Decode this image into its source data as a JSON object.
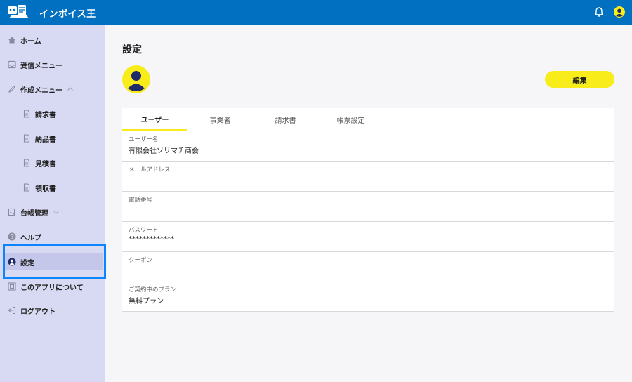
{
  "header": {
    "app_title": "インボイス王",
    "logo_icon": "app-logo-icon",
    "bell_icon": "bell-icon",
    "account_icon": "account-avatar-icon",
    "color": "#0270c0"
  },
  "sidebar": {
    "background": "#d8d9f3",
    "items": [
      {
        "label": "ホーム",
        "icon": "home-icon"
      },
      {
        "label": "受信メニュー",
        "icon": "inbox-icon"
      },
      {
        "label": "作成メニュー",
        "icon": "pencil-icon",
        "expanded": true
      },
      {
        "label": "請求書",
        "icon": "document-icon"
      },
      {
        "label": "納品書",
        "icon": "document-icon"
      },
      {
        "label": "見積書",
        "icon": "document-icon"
      },
      {
        "label": "領収書",
        "icon": "document-icon"
      },
      {
        "label": "台帳管理",
        "icon": "ledger-icon",
        "expanded": false
      },
      {
        "label": "ヘルプ",
        "icon": "help-icon"
      },
      {
        "label": "設定",
        "icon": "user-circle-icon",
        "active": true
      },
      {
        "label": "このアプリについて",
        "icon": "info-icon"
      },
      {
        "label": "ログアウト",
        "icon": "logout-icon"
      }
    ]
  },
  "main": {
    "title": "設定",
    "edit_label": "編集",
    "accent": "#f8ec1a",
    "tabs": [
      {
        "label": "ユーザー",
        "active": true
      },
      {
        "label": "事業者"
      },
      {
        "label": "請求書"
      },
      {
        "label": "帳票設定"
      }
    ],
    "fields": [
      {
        "label": "ユーザー名",
        "value": "有限会社ソリマチ商会"
      },
      {
        "label": "メールアドレス",
        "value": ""
      },
      {
        "label": "電話番号",
        "value": ""
      },
      {
        "label": "パスワード",
        "value": "*************"
      },
      {
        "label": "クーポン",
        "value": ""
      },
      {
        "label": "ご契約中のプラン",
        "value": "無料プラン"
      }
    ]
  }
}
